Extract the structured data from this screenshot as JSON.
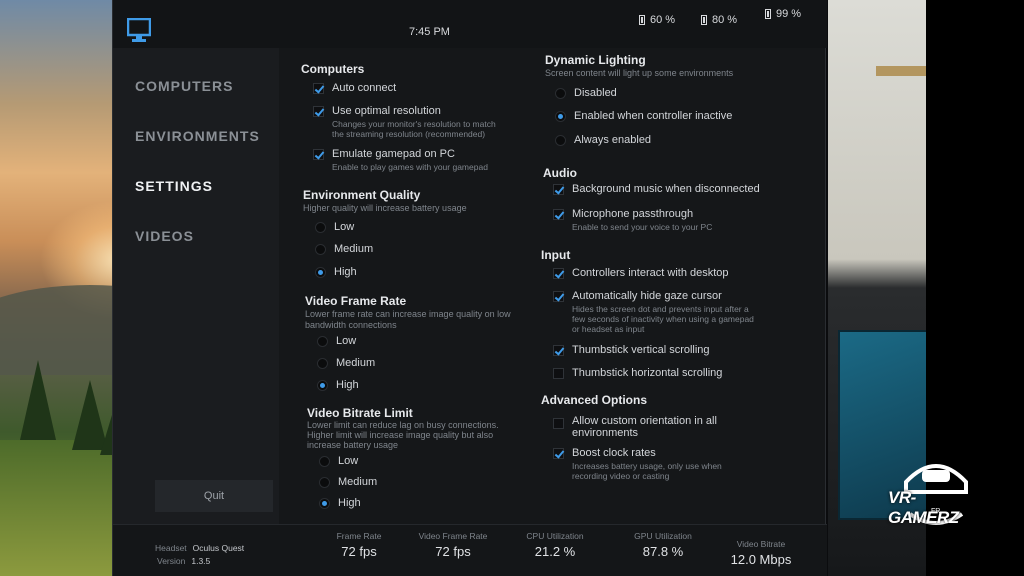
{
  "header": {
    "time": "7:45 PM",
    "batteries": [
      "60 %",
      "80 %",
      "99 %"
    ]
  },
  "sidebar": {
    "items": [
      {
        "label": "COMPUTERS"
      },
      {
        "label": "ENVIRONMENTS"
      },
      {
        "label": "SETTINGS",
        "active": true
      },
      {
        "label": "VIDEOS"
      }
    ],
    "quit_label": "Quit"
  },
  "computers": {
    "title": "Computers",
    "auto_connect": "Auto connect",
    "optimal_resolution": "Use optimal resolution",
    "optimal_resolution_desc1": "Changes your monitor's resolution to match",
    "optimal_resolution_desc2": "the streaming resolution (recommended)",
    "emulate_gamepad": "Emulate gamepad on PC",
    "emulate_gamepad_desc": "Enable to play games with your gamepad"
  },
  "env_quality": {
    "title": "Environment Quality",
    "subtitle": "Higher quality will increase battery usage",
    "options": [
      "Low",
      "Medium",
      "High"
    ],
    "selected": "High"
  },
  "frame_rate": {
    "title": "Video Frame Rate",
    "subtitle1": "Lower frame rate can increase image quality on low",
    "subtitle2": "bandwidth connections",
    "options": [
      "Low",
      "Medium",
      "High"
    ],
    "selected": "High"
  },
  "bitrate": {
    "title": "Video Bitrate Limit",
    "subtitle1": "Lower limit can reduce lag on busy connections.",
    "subtitle2": "Higher limit will increase image quality but also",
    "subtitle3": "increase battery usage",
    "options": [
      "Low",
      "Medium",
      "High"
    ],
    "selected": "High"
  },
  "lighting": {
    "title": "Dynamic Lighting",
    "subtitle": "Screen content will light up some environments",
    "options": [
      "Disabled",
      "Enabled when controller inactive",
      "Always enabled"
    ],
    "selected": "Enabled when controller inactive"
  },
  "audio": {
    "title": "Audio",
    "bg_music": "Background music when disconnected",
    "mic": "Microphone passthrough",
    "mic_desc": "Enable to send your voice to your PC"
  },
  "input": {
    "title": "Input",
    "controllers": "Controllers interact with desktop",
    "hide_gaze": "Automatically hide gaze cursor",
    "hide_gaze_desc1": "Hides the screen dot and prevents input after a",
    "hide_gaze_desc2": "few seconds of inactivity when using a gamepad",
    "hide_gaze_desc3": "or headset as input",
    "thumb_vertical": "Thumbstick vertical scrolling",
    "thumb_horizontal": "Thumbstick horizontal scrolling"
  },
  "advanced": {
    "title": "Advanced Options",
    "custom_orientation1": "Allow custom orientation in all",
    "custom_orientation2": "environments",
    "boost_clock": "Boost clock rates",
    "boost_clock_desc1": "Increases battery usage, only use when",
    "boost_clock_desc2": "recording video or casting"
  },
  "status": {
    "headset_label": "Headset",
    "headset_value": "Oculus Quest",
    "version_label": "Version",
    "version_value": "1.3.5",
    "stats": [
      {
        "label": "Frame Rate",
        "value": "72 fps"
      },
      {
        "label": "Video Frame Rate",
        "value": "72 fps"
      },
      {
        "label": "CPU Utilization",
        "value": "21.2 %"
      },
      {
        "label": "GPU Utilization",
        "value": "87.8 %"
      },
      {
        "label": "Video Bitrate",
        "value": "12.0 Mbps"
      }
    ]
  },
  "watermark": {
    "text": "VR-GAMERZ",
    "sub": "FR"
  },
  "colors": {
    "accent": "#3f9be8",
    "panel": "#151719",
    "sidebar": "#1a1c1f"
  }
}
